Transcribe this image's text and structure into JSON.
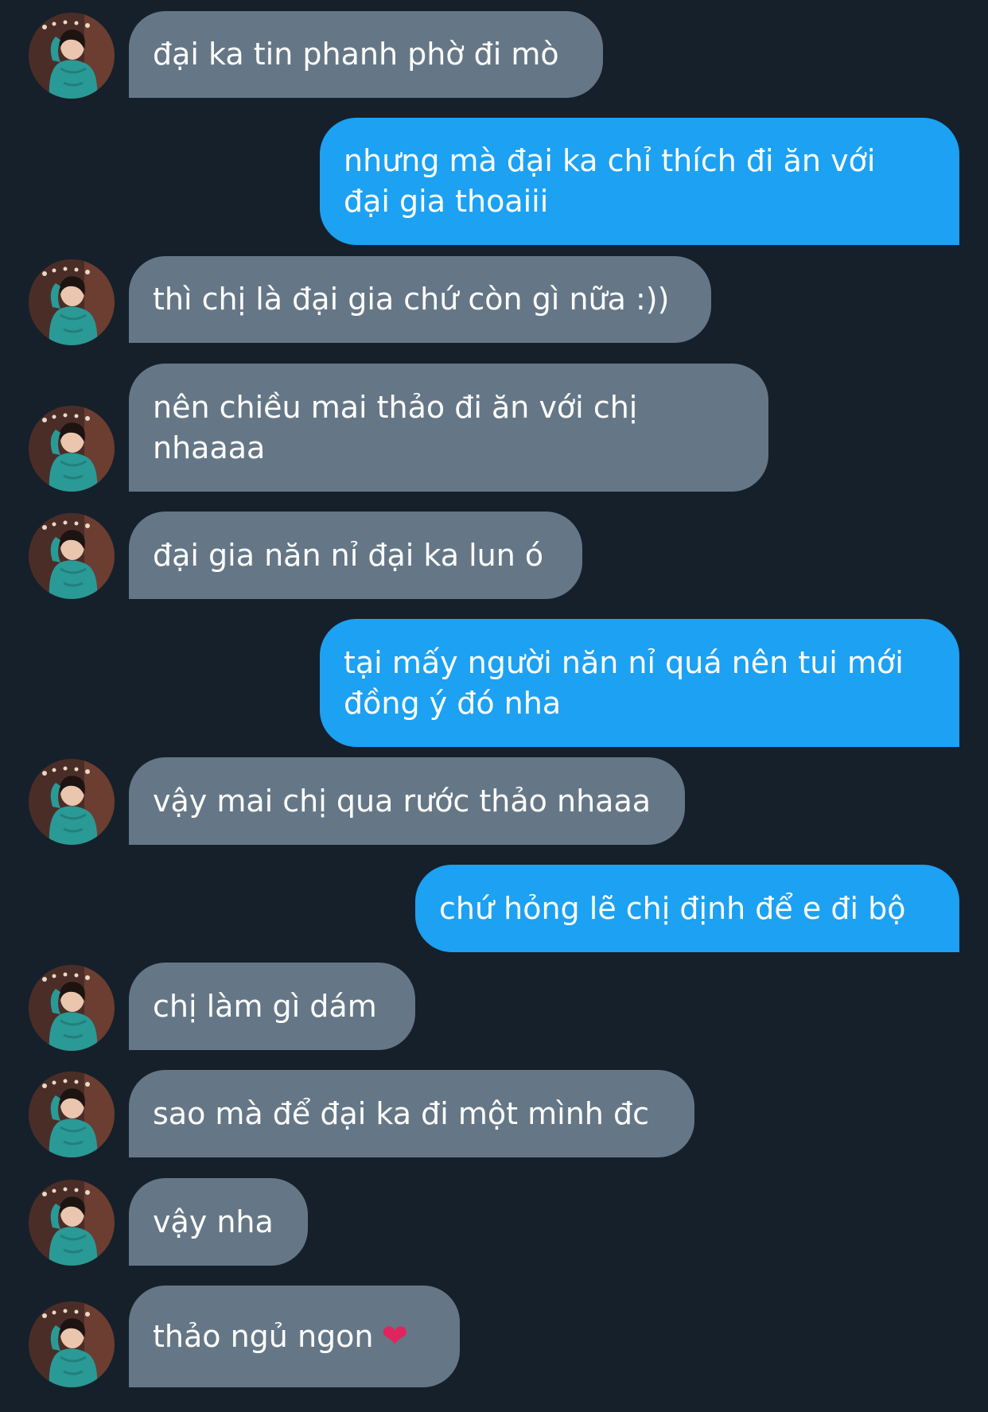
{
  "messages": [
    {
      "side": "in",
      "text": "đại ka tin phanh phờ đi mò"
    },
    {
      "side": "out",
      "text": "nhưng mà đại ka chỉ thích đi ăn với\nđại gia thoaiii"
    },
    {
      "side": "in",
      "text": "thì chị là đại gia chứ còn gì nữa :))"
    },
    {
      "side": "in",
      "text": "nên chiều mai thảo đi ăn với chị\nnhaaaa"
    },
    {
      "side": "in",
      "text": "đại gia năn nỉ đại ka lun ó"
    },
    {
      "side": "out",
      "text": "tại mấy người năn nỉ quá nên tui mới\nđồng ý đó nha"
    },
    {
      "side": "in",
      "text": "vậy mai chị qua rước thảo nhaaa"
    },
    {
      "side": "out",
      "text": "chứ hỏng lẽ chị định để e đi bộ"
    },
    {
      "side": "in",
      "text": "chị làm gì dám"
    },
    {
      "side": "in",
      "text": "sao mà để đại ka đi một mình đc"
    },
    {
      "side": "in",
      "text": "vậy nha"
    },
    {
      "side": "in",
      "text": "thảo ngủ ngon",
      "emoji": "❤"
    }
  ],
  "colors": {
    "background": "#15202b",
    "incoming_bubble": "#657786",
    "outgoing_bubble": "#1da1f2",
    "text": "#ffffff",
    "heart": "#e0245e"
  },
  "icons": {
    "avatar": "profile-photo-avatar",
    "heart": "red-heart-emoji"
  }
}
